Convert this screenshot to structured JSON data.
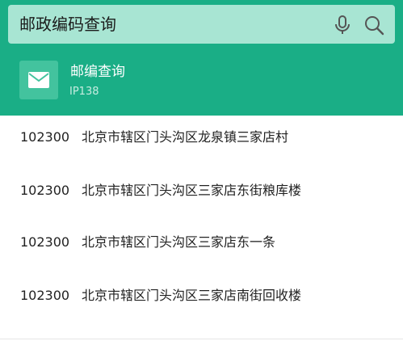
{
  "search": {
    "query": "邮政编码查询"
  },
  "icons": {
    "mic": "microphone-icon",
    "search": "search-icon",
    "app": "mail-icon"
  },
  "colors": {
    "header_bg": "#1aae86",
    "searchbar_bg": "#a8e5d3",
    "app_icon_bg": "#43c39e"
  },
  "app": {
    "title": "邮编查询",
    "subtitle": "IP138"
  },
  "results": [
    {
      "code": "102300",
      "address": "北京市辖区门头沟区龙泉镇三家店村"
    },
    {
      "code": "102300",
      "address": "北京市辖区门头沟区三家店东街粮库楼"
    },
    {
      "code": "102300",
      "address": "北京市辖区门头沟区三家店东一条"
    },
    {
      "code": "102300",
      "address": "北京市辖区门头沟区三家店南街回收楼"
    }
  ]
}
